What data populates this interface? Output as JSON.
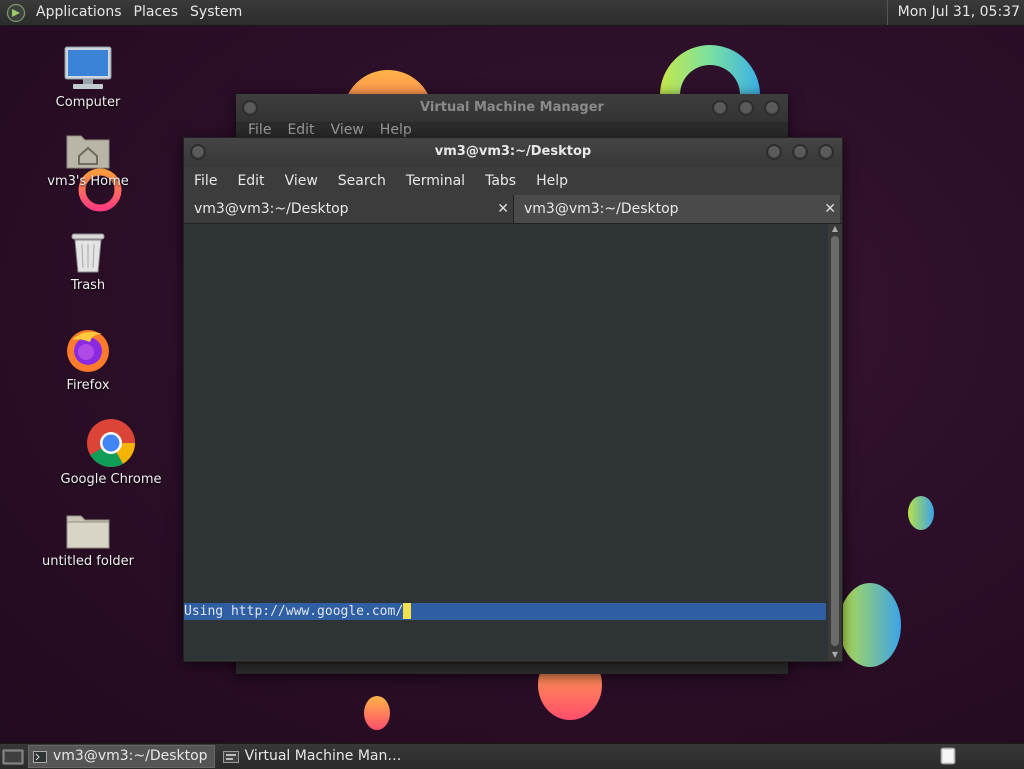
{
  "top_panel": {
    "applications": "Applications",
    "places": "Places",
    "system": "System",
    "clock": "Mon Jul 31, 05:37"
  },
  "desktop": {
    "icons": [
      {
        "label": "Computer",
        "icon": "computer-icon"
      },
      {
        "label": "vm3's Home",
        "icon": "home-folder-icon"
      },
      {
        "label": "Trash",
        "icon": "trash-icon"
      },
      {
        "label": "Firefox",
        "icon": "firefox-icon"
      },
      {
        "label": "Google Chrome",
        "icon": "chrome-icon"
      },
      {
        "label": "untitled folder",
        "icon": "folder-icon"
      }
    ]
  },
  "vmm_window": {
    "title": "Virtual Machine Manager",
    "menu": [
      "File",
      "Edit",
      "View",
      "Help"
    ]
  },
  "terminal_window": {
    "title": "vm3@vm3:~/Desktop",
    "menu": [
      "File",
      "Edit",
      "View",
      "Search",
      "Terminal",
      "Tabs",
      "Help"
    ],
    "tabs": [
      {
        "label": "vm3@vm3:~/Desktop",
        "active": true
      },
      {
        "label": "vm3@vm3:~/Desktop",
        "active": false
      }
    ],
    "output_line": "Using http://www.google.com/"
  },
  "taskbar": {
    "items": [
      {
        "label": "vm3@vm3:~/Desktop",
        "icon": "terminal-icon",
        "active": true
      },
      {
        "label": "Virtual Machine Man…",
        "icon": "vmm-icon",
        "active": false
      }
    ]
  },
  "colors": {
    "panel": "#2c2c2c",
    "terminal_bg": "#2e3436",
    "selection": "#2f5ea3",
    "cursor": "#f4e04d"
  }
}
